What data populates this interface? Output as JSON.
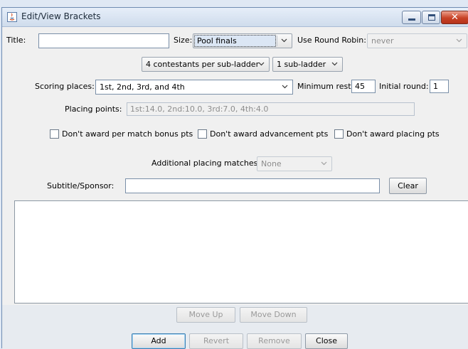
{
  "window": {
    "title": "Edit/View Brackets",
    "close_glyph": "✕"
  },
  "row1": {
    "title_label": "Title:",
    "title_value": "",
    "size_label": "Size:",
    "size_value": "Pool finals",
    "rr_label": "Use Round Robin:",
    "rr_value": "never"
  },
  "row2": {
    "contestants_value": "4 contestants per sub-ladder",
    "subladder_value": "1 sub-ladder"
  },
  "row3": {
    "scoring_label": "Scoring places:",
    "scoring_value": "1st, 2nd, 3rd, and 4th",
    "min_rest_label": "Minimum rest:",
    "min_rest_value": "45",
    "initial_round_label": "Initial round:",
    "initial_round_value": "1"
  },
  "row4": {
    "placing_label": "Placing points:",
    "placing_value": "1st:14.0, 2nd:10.0, 3rd:7.0, 4th:4.0"
  },
  "checkboxes": [
    {
      "label": "Don't award per match bonus pts",
      "checked": false
    },
    {
      "label": "Don't award advancement pts",
      "checked": false
    },
    {
      "label": "Don't award placing pts",
      "checked": false
    }
  ],
  "row6": {
    "additional_label": "Additional placing matches:",
    "additional_value": "None"
  },
  "row7": {
    "subtitle_label": "Subtitle/Sponsor:",
    "subtitle_value": "",
    "clear_label": "Clear"
  },
  "list_items": [],
  "move": {
    "up_label": "Move Up",
    "down_label": "Move Down"
  },
  "actions": {
    "add_label": "Add",
    "revert_label": "Revert",
    "remove_label": "Remove",
    "close_label": "Close"
  }
}
